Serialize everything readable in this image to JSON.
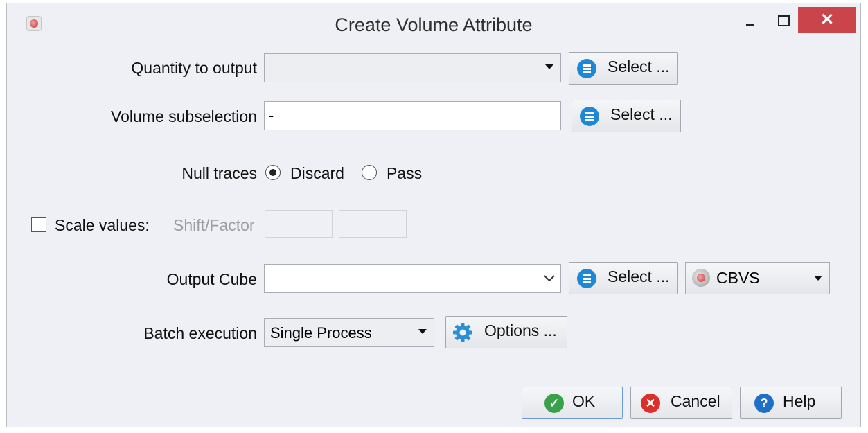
{
  "window": {
    "title": "Create Volume Attribute",
    "close_glyph": "✕"
  },
  "form": {
    "quantity": {
      "label": "Quantity to output",
      "value": "",
      "select_label": "Select ..."
    },
    "volume_subsel": {
      "label": "Volume subselection",
      "value": "-",
      "select_label": "Select ..."
    },
    "null_traces": {
      "label": "Null traces",
      "options": [
        "Discard",
        "Pass"
      ],
      "selected": "Discard"
    },
    "scale": {
      "label": "Scale values:",
      "sublabel": "Shift/Factor",
      "checked": false,
      "shift": "",
      "factor": ""
    },
    "output_cube": {
      "label": "Output Cube",
      "value": "",
      "select_label": "Select ...",
      "format": "CBVS"
    },
    "batch": {
      "label": "Batch execution",
      "value": "Single Process",
      "options_label": "Options ..."
    }
  },
  "footer": {
    "ok": "OK",
    "cancel": "Cancel",
    "help": "Help"
  },
  "icons": {
    "list": "list-icon",
    "gear": "gear-icon",
    "ok": "check-circle-icon",
    "cancel": "x-circle-icon",
    "help": "question-circle-icon",
    "format": "cube-icon"
  },
  "colors": {
    "select_icon": "#1e88d6",
    "ok_icon": "#3aa14a",
    "cancel_icon": "#d9302c",
    "help_icon": "#1f6fc9",
    "close_button": "#c9454a"
  }
}
